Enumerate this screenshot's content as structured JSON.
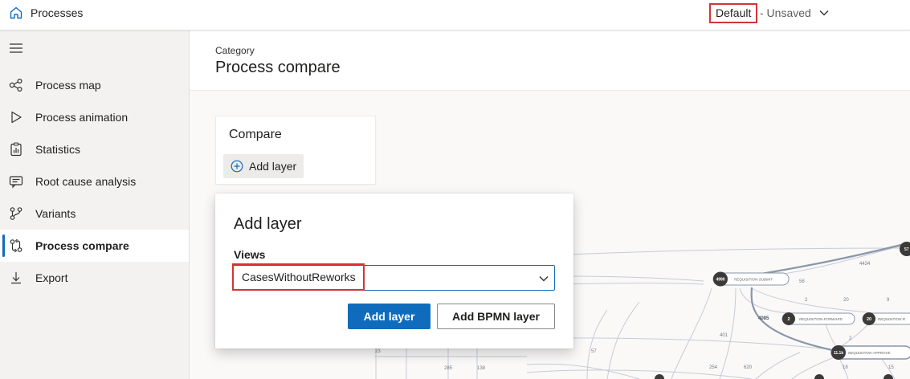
{
  "app": {
    "title": "Processes",
    "home_icon": "home-icon"
  },
  "view": {
    "name": "Default",
    "state": "- Unsaved",
    "chevron_icon": "chevron-down-icon"
  },
  "sidebar": {
    "menu_icon": "hamburger-menu-icon",
    "items": [
      {
        "label": "Process map",
        "icon": "process-map-icon",
        "active": false
      },
      {
        "label": "Process animation",
        "icon": "play-icon",
        "active": false
      },
      {
        "label": "Statistics",
        "icon": "clipboard-chart-icon",
        "active": false
      },
      {
        "label": "Root cause analysis",
        "icon": "root-cause-icon",
        "active": false
      },
      {
        "label": "Variants",
        "icon": "variants-icon",
        "active": false
      },
      {
        "label": "Process compare",
        "icon": "compare-icon",
        "active": true
      },
      {
        "label": "Export",
        "icon": "export-icon",
        "active": false
      }
    ]
  },
  "header": {
    "category": "Category",
    "title": "Process compare"
  },
  "compare_card": {
    "title": "Compare",
    "add_label": "Add layer"
  },
  "dialog": {
    "title": "Add layer",
    "views_label": "Views",
    "views_value": "CasesWithoutReworks",
    "primary_button": "Add layer",
    "secondary_button": "Add BPMN layer"
  },
  "process_map": {
    "nodes": [
      {
        "count": "4990",
        "label": "REQUISITION-SUBMIT"
      },
      {
        "count": "2",
        "label": "REQUISITION-FORWARD"
      },
      {
        "count": "20",
        "label": "REQUISITION-R"
      },
      {
        "count": "11.1k",
        "label": "REQUISITION-APPROVE"
      },
      {
        "count": "57",
        "label": ""
      }
    ],
    "edge_labels": [
      "4434",
      "58",
      "2",
      "20",
      "9",
      "4085",
      "401",
      "2",
      "23",
      "57",
      "285",
      "138",
      "254",
      "620",
      "18",
      "15"
    ]
  },
  "colors": {
    "accent": "#0f6cbd",
    "highlight": "#d13438",
    "node": "#3b3a39"
  }
}
